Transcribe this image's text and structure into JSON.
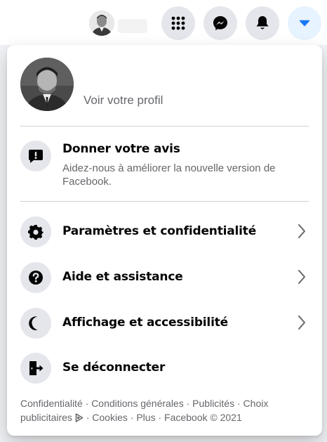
{
  "topbar": {
    "avatar": "user-avatar",
    "buttons": [
      {
        "name": "menu-grid-icon"
      },
      {
        "name": "messenger-icon"
      },
      {
        "name": "bell-icon"
      },
      {
        "name": "caret-down-icon"
      }
    ]
  },
  "panel": {
    "profile": {
      "label": "Voir votre profil"
    },
    "feedback": {
      "title": "Donner votre avis",
      "subtitle": "Aidez-nous à améliorer la nouvelle version de Facebook."
    },
    "menu": [
      {
        "label": "Paramètres et confidentialité",
        "icon": "gear-icon",
        "chevron": true
      },
      {
        "label": "Aide et assistance",
        "icon": "question-icon",
        "chevron": true
      },
      {
        "label": "Affichage et accessibilité",
        "icon": "moon-icon",
        "chevron": true
      },
      {
        "label": "Se déconnecter",
        "icon": "logout-icon",
        "chevron": false
      }
    ],
    "footer": {
      "privacy": "Confidentialité",
      "terms": "Conditions générales",
      "ads": "Publicités",
      "adchoices": "Choix publicitaires",
      "cookies": "Cookies",
      "more": "Plus",
      "copyright": "Facebook © 2021",
      "separator": " · "
    }
  },
  "colors": {
    "accent": "#1877f2",
    "accent_bg": "#e7f3ff",
    "icon_bg": "#e4e6eb",
    "secondary_text": "#65676b",
    "divider": "#ced0d4"
  }
}
